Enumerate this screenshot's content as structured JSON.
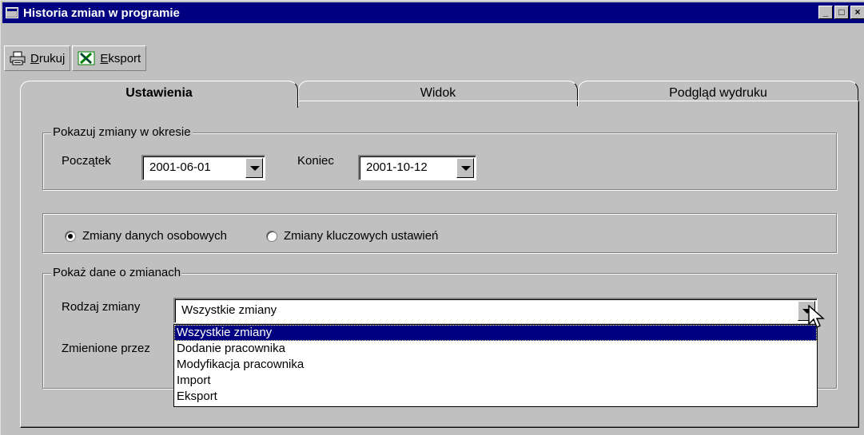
{
  "window": {
    "title": "Historia zmian w programie",
    "buttons": [
      "_",
      "□",
      "X"
    ]
  },
  "toolbar": {
    "print_label": "Drukuj",
    "print_access": "D",
    "print_rest": "rukuj",
    "export_label": "Eksport",
    "export_access": "E",
    "export_rest": "ksport"
  },
  "tabs": [
    {
      "label": "Ustawienia",
      "active": true
    },
    {
      "label": "Widok",
      "active": false
    },
    {
      "label": "Podgląd wydruku",
      "active": false
    }
  ],
  "period": {
    "legend": "Pokazuj zmiany w okresie",
    "start_label": "Początek",
    "start_value": "2001-06-01",
    "end_label": "Koniec",
    "end_value": "2001-10-12"
  },
  "mode": {
    "option1": "Zmiany danych osobowych",
    "option1_selected": true,
    "option2": "Zmiany kluczowych ustawień",
    "option2_selected": false
  },
  "details": {
    "legend": "Pokaż dane o zmianach",
    "type_label": "Rodzaj zmiany",
    "type_value": "Wszystkie zmiany",
    "changed_by_label": "Zmienione przez",
    "options": [
      "Wszystkie zmiany",
      "Dodanie pracownika",
      "Modyfikacja pracownika",
      "Import",
      "Eksport"
    ],
    "selected_index": 0
  },
  "colors": {
    "titlebar": "#000080",
    "face": "#c0c0c0",
    "selection": "#000080"
  }
}
